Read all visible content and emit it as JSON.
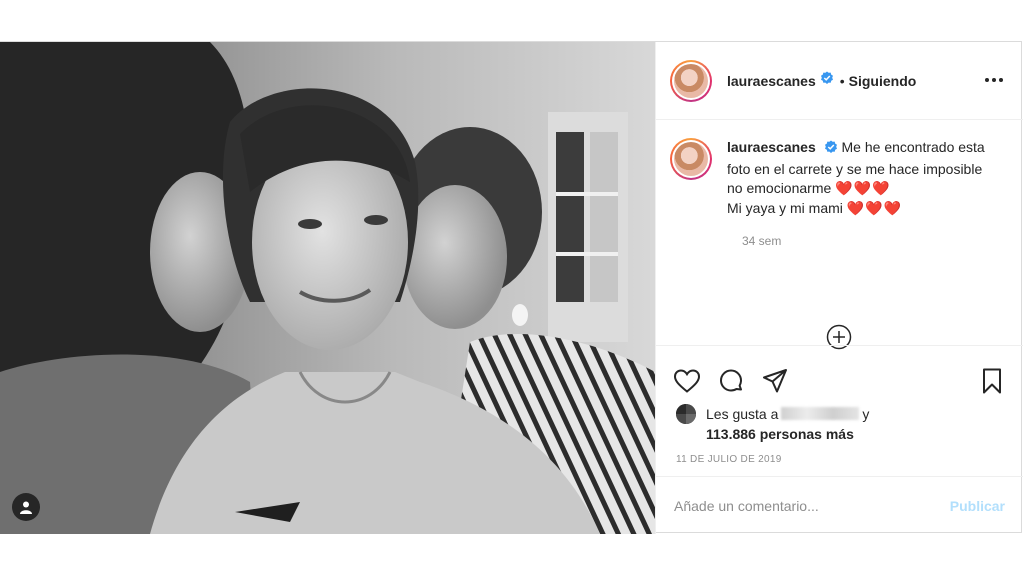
{
  "post": {
    "username": "lauraescanes",
    "follow_status": "Siguiendo",
    "separator": "•",
    "caption": {
      "username": "lauraescanes",
      "text_line1": "Me he encontrado esta foto en el carrete y se me hace imposible no emocionarme",
      "hearts1": "❤️❤️❤️",
      "text_line2": "Mi yaya y mi mami",
      "hearts2": "❤️❤️❤️",
      "time_ago": "34 sem"
    },
    "likes": {
      "prefix": "Les gusta a",
      "suffix": "y",
      "count": "113.886 personas más"
    },
    "date": "11 DE JULIO DE 2019",
    "comment": {
      "placeholder": "Añade un comentario...",
      "publish_label": "Publicar"
    }
  },
  "icons": {
    "verified": "verified-badge-icon",
    "more": "more-options-icon",
    "like": "heart-icon",
    "comment": "comment-icon",
    "share": "share-icon",
    "save": "bookmark-icon",
    "load_more": "plus-circle-icon",
    "tagged": "user-tag-icon"
  },
  "colors": {
    "verified_blue": "#3897f0",
    "heart_red": "#e0112b",
    "publish_disabled": "#b2dffc",
    "muted_text": "#8e8e8e"
  }
}
